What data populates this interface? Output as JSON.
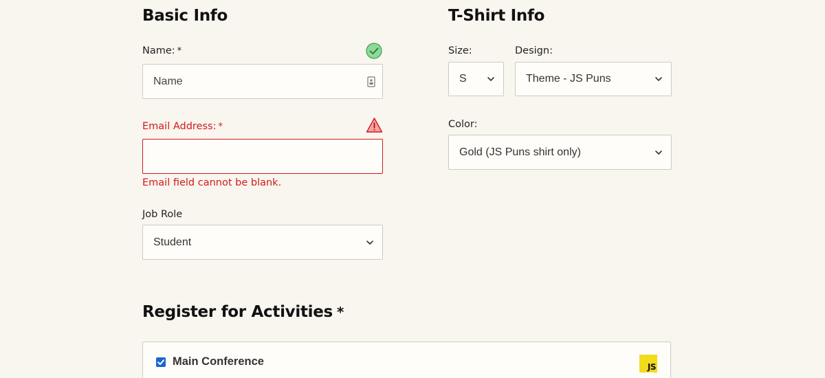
{
  "basic_info": {
    "heading": "Basic Info",
    "name": {
      "label": "Name:",
      "required_mark": "*",
      "placeholder": "Name",
      "value": "",
      "status_icon": "checkmark-circle-icon",
      "status": "valid"
    },
    "email": {
      "label": "Email Address:",
      "required_mark": "*",
      "value": "",
      "status_icon": "warning-triangle-icon",
      "status": "invalid",
      "error_message": "Email field cannot be blank."
    },
    "job_role": {
      "label": "Job Role",
      "selected": "Student"
    }
  },
  "tshirt_info": {
    "heading": "T-Shirt Info",
    "size": {
      "label": "Size:",
      "selected": "S"
    },
    "design": {
      "label": "Design:",
      "selected": "Theme - JS Puns"
    },
    "color": {
      "label": "Color:",
      "selected": "Gold (JS Puns shirt only)"
    }
  },
  "activities": {
    "heading": "Register for Activities",
    "required_mark": "*",
    "items": [
      {
        "label": "Main Conference",
        "checked": true,
        "logo_text": "JS",
        "logo_icon": "javascript-logo-icon"
      }
    ]
  },
  "colors": {
    "background": "#f9f5ef",
    "error": "#d11a1a",
    "valid": "#3aa34a",
    "checkbox": "#1a66d2",
    "js_logo": "#f0db1d"
  }
}
